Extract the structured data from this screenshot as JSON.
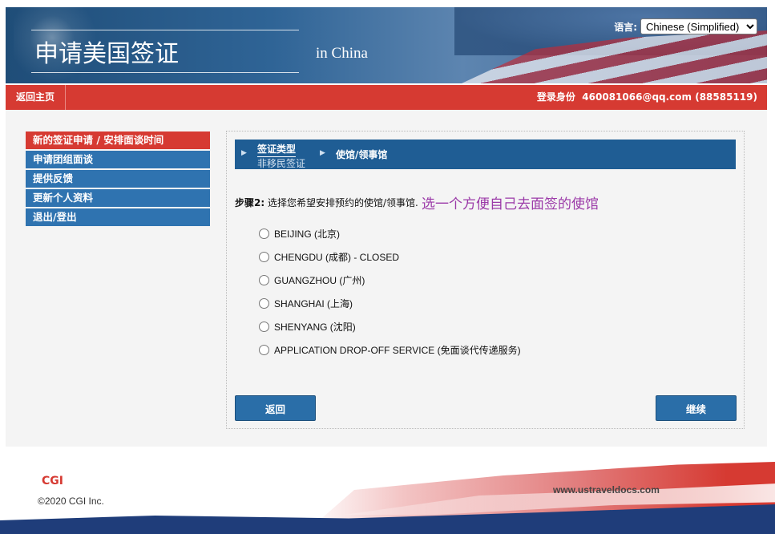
{
  "header": {
    "title_cn": "申请美国签证",
    "title_en": "in China",
    "language_label": "语言:",
    "language_selected": "Chinese (Simplified)"
  },
  "topbar": {
    "home_label": "返回主页",
    "login_label": "登录身份",
    "login_user": "460081066@qq.com (88585119)"
  },
  "sidebar": {
    "items": [
      {
        "label": "新的签证申请 / 安排面谈时间",
        "active": true
      },
      {
        "label": "申请团组面谈"
      },
      {
        "label": "提供反馈"
      },
      {
        "label": "更新个人资料"
      },
      {
        "label": "退出/登出"
      }
    ]
  },
  "steps": {
    "step1_title": "签证类型",
    "step1_value": "非移民签证",
    "step2_title": "使馆/领事馆"
  },
  "instruction": {
    "step_label": "步骤2:",
    "text": "选择您希望安排预约的使馆/领事馆.",
    "note": "选一个方便自己去面签的使馆"
  },
  "options": [
    "BEIJING (北京)",
    "CHENGDU (成都) - CLOSED",
    "GUANGZHOU (广州)",
    "SHANGHAI (上海)",
    "SHENYANG (沈阳)",
    "APPLICATION DROP-OFF SERVICE (免面谈代传递服务)"
  ],
  "buttons": {
    "back": "返回",
    "next": "继续"
  },
  "footer": {
    "brand": "CGI",
    "copyright": "©2020 CGI Inc.",
    "site": "www.ustraveldocs.com"
  }
}
